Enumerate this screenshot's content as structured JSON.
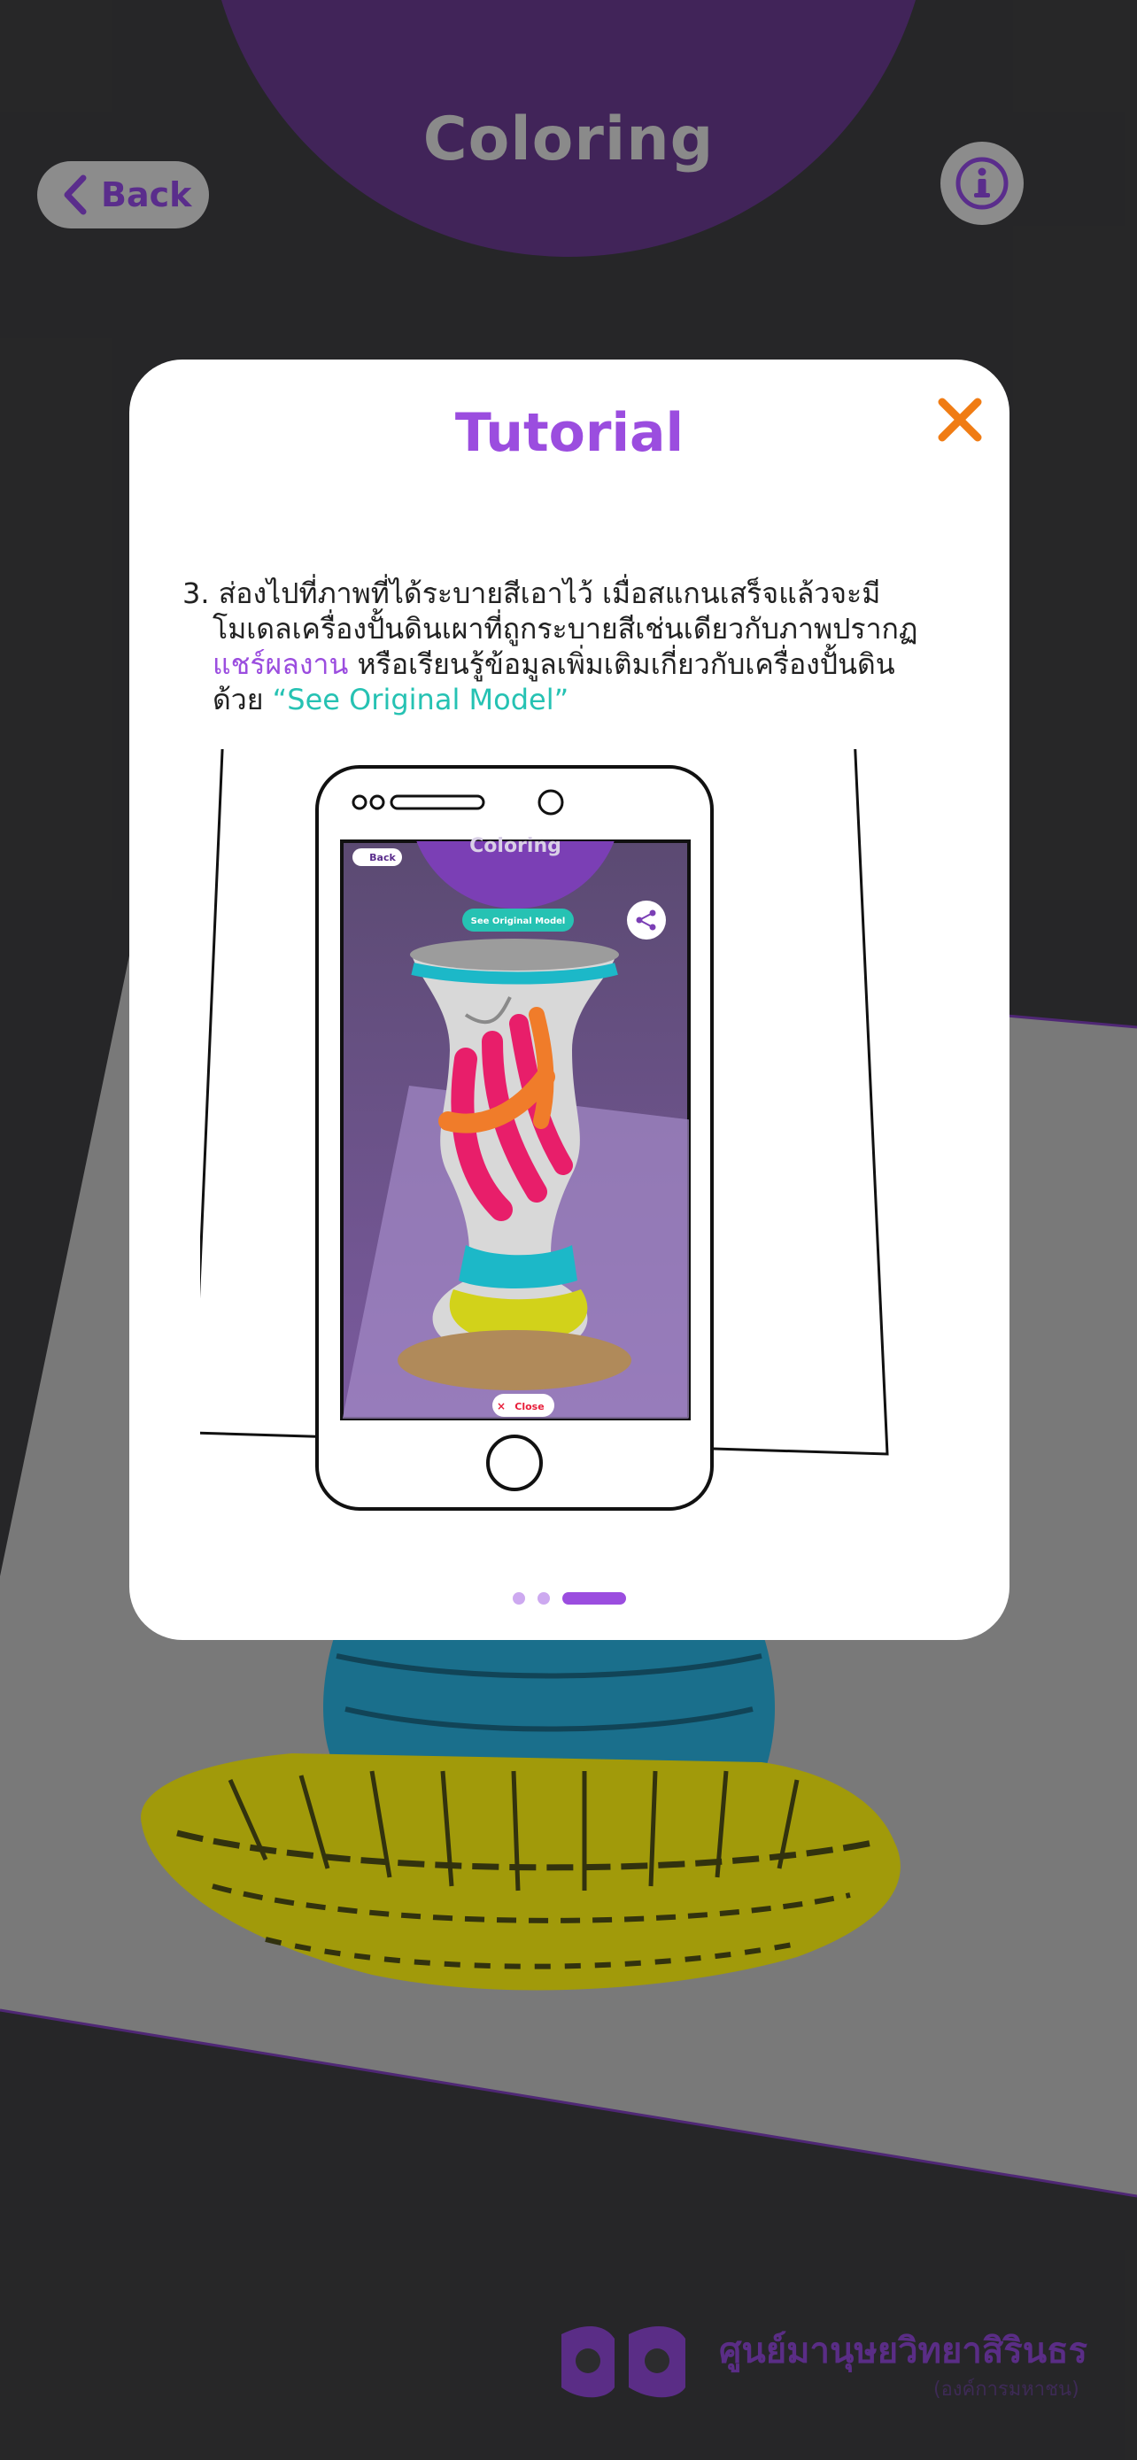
{
  "header": {
    "title": "Coloring",
    "back_label": "Back",
    "info_icon": "info-icon"
  },
  "modal": {
    "title": "Tutorial",
    "close_icon": "close-icon",
    "instruction": {
      "line1": "3. ส่องไปที่ภาพที่ได้ระบายสีเอาไว้ เมื่อสแกนเสร็จแล้วจะมี",
      "line2": "โมเดลเครื่องปั้นดินเผาที่ถูกระบายสีเช่นเดียวกับภาพปรากฏ",
      "share_text": "แชร์ผลงาน",
      "line3_rest": " หรือเรียนรู้ข้อมูลเพิ่มเติมเกี่ยวกับเครื่องปั้นดิน",
      "line4_prefix": "ด้วย ",
      "model_link": "“See Original Model”"
    },
    "illustration": {
      "phone_back_label": "Back",
      "phone_title": "Coloring",
      "phone_see_original": "See Original Model",
      "phone_close": "Close",
      "share_icon": "share-icon"
    },
    "pager": {
      "total": 3,
      "current": 3
    }
  },
  "logo": {
    "name": "ศูนย์มานุษยวิทยาสิรินธร",
    "sub": "(องค์การมหาชน)"
  },
  "colors": {
    "accent_purple": "#9b4ddf",
    "close_orange": "#f07c14",
    "teal": "#26c2b3",
    "background": "#2c2c2e"
  }
}
